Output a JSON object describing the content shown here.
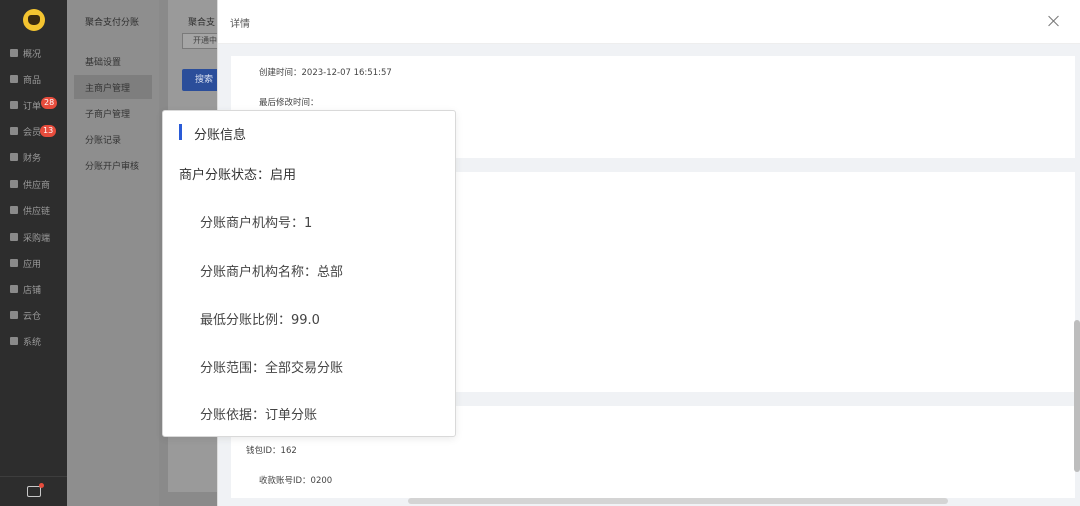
{
  "sidebar": {
    "items": [
      {
        "label": "概况",
        "icon": "dashboard-icon"
      },
      {
        "label": "商品",
        "icon": "product-icon"
      },
      {
        "label": "订单",
        "icon": "order-icon",
        "badge": "28"
      },
      {
        "label": "会员",
        "icon": "member-icon",
        "badge": "13"
      },
      {
        "label": "财务",
        "icon": "finance-icon"
      },
      {
        "label": "供应商",
        "icon": "supplier-icon"
      },
      {
        "label": "供应链",
        "icon": "supply-chain-icon"
      },
      {
        "label": "采购端",
        "icon": "purchase-icon"
      },
      {
        "label": "应用",
        "icon": "app-icon"
      },
      {
        "label": "店铺",
        "icon": "store-icon"
      },
      {
        "label": "云仓",
        "icon": "cloud-warehouse-icon"
      },
      {
        "label": "系统",
        "icon": "system-icon"
      }
    ]
  },
  "submenu": {
    "title": "聚合支付分账",
    "items": [
      {
        "label": "基础设置",
        "active": false
      },
      {
        "label": "主商户管理",
        "active": true
      },
      {
        "label": "子商户管理",
        "active": false
      },
      {
        "label": "分账记录",
        "active": false
      },
      {
        "label": "分账开户审核",
        "active": false
      }
    ]
  },
  "main": {
    "tab": "聚合支",
    "input_value": "开通中",
    "search_label": "搜索"
  },
  "drawer": {
    "title": "详情",
    "created_time": "创建时间：2023-12-07 16:51:57",
    "modified_time": "最后修改时间：",
    "wallet_id": "钱包ID：162",
    "receive_account_id": "收款账号ID：0200"
  },
  "popup": {
    "title": "分账信息",
    "status": "商户分账状态：启用",
    "rows": [
      "分账商户机构号：1",
      "分账商户机构名称：总部",
      "最低分账比例：99.0",
      "分账范围：全部交易分账",
      "分账依据：订单分账"
    ]
  },
  "colors": {
    "sidebar_bg": "#2d2d2d",
    "accent": "#2a5bd7",
    "badge": "#e74c3c"
  }
}
